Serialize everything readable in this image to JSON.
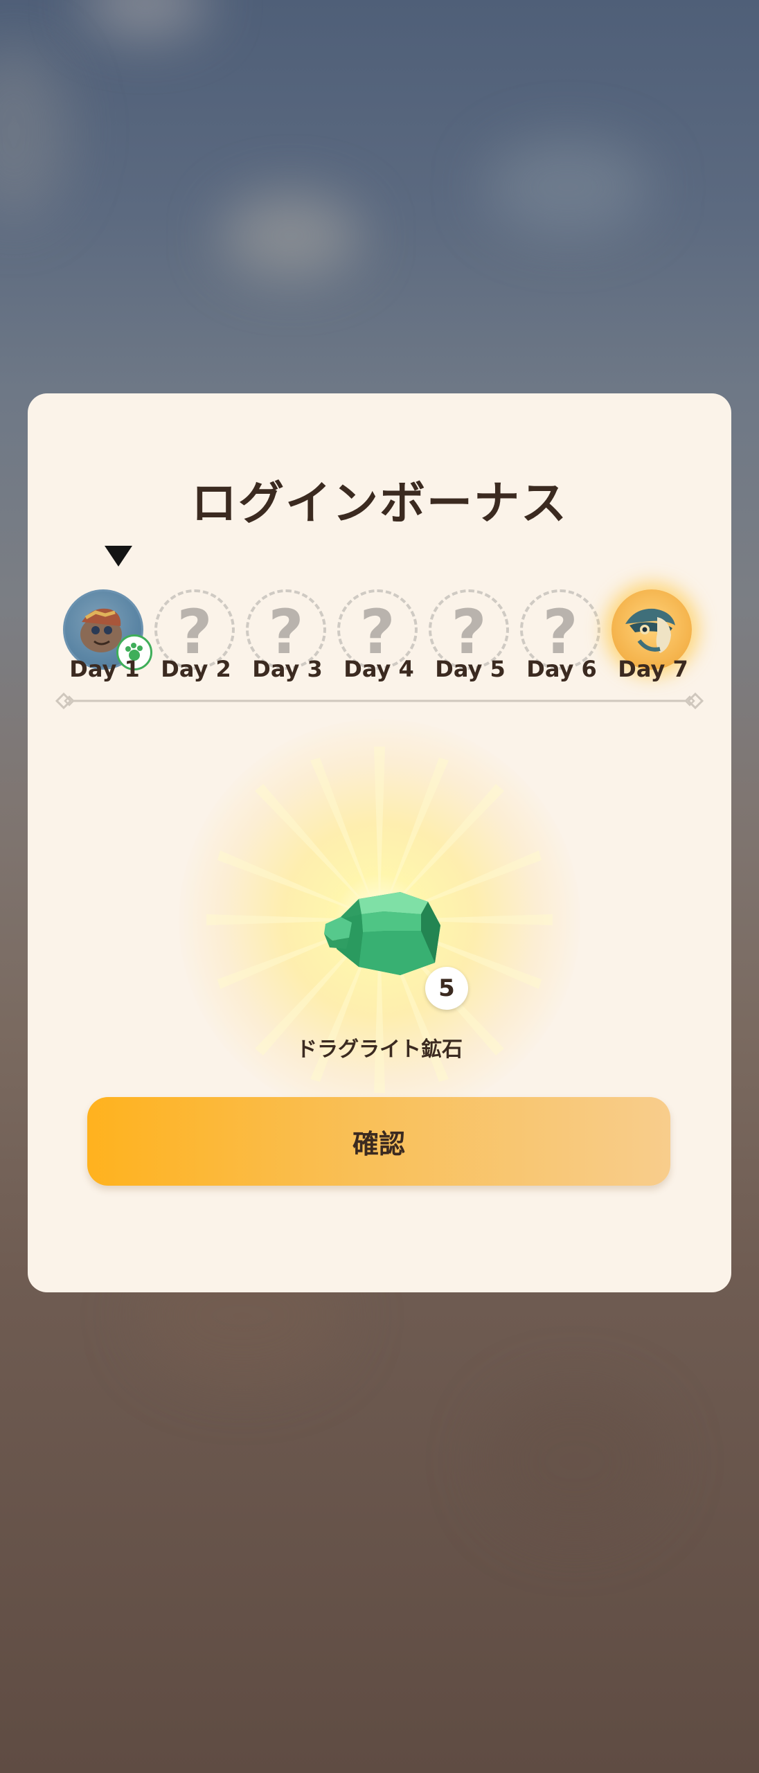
{
  "dialog": {
    "title": "ログインボーナス"
  },
  "days": [
    {
      "label": "Day 1",
      "state": "current",
      "icon": "character-reward-icon"
    },
    {
      "label": "Day 2",
      "state": "locked",
      "icon": "question-mark-icon",
      "mark": "?"
    },
    {
      "label": "Day 3",
      "state": "locked",
      "icon": "question-mark-icon",
      "mark": "?"
    },
    {
      "label": "Day 4",
      "state": "locked",
      "icon": "question-mark-icon",
      "mark": "?"
    },
    {
      "label": "Day 5",
      "state": "locked",
      "icon": "question-mark-icon",
      "mark": "?"
    },
    {
      "label": "Day 6",
      "state": "locked",
      "icon": "question-mark-icon",
      "mark": "?"
    },
    {
      "label": "Day 7",
      "state": "special",
      "icon": "character-reward-icon"
    }
  ],
  "reward": {
    "name": "ドラグライト鉱石",
    "count": "5",
    "icon": "green-ore-icon"
  },
  "confirm_button": {
    "label": "確認"
  },
  "colors": {
    "card_background": "#fbf3e9",
    "text": "#3b2a20",
    "button_start": "#ffb21e",
    "button_end": "#f8cd8c",
    "ore_green": "#3fbf7a"
  }
}
